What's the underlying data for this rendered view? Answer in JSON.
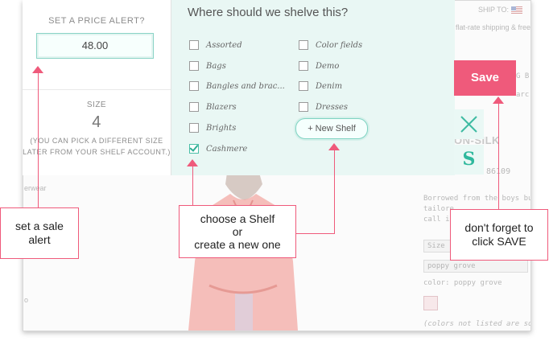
{
  "price_alert": {
    "heading": "SET A PRICE ALERT?",
    "value": "48.00"
  },
  "size": {
    "heading": "SIZE",
    "value": "4",
    "note_line1": "(YOU CAN PICK A DIFFERENT SIZE",
    "note_line2": "LATER FROM YOUR SHELF ACCOUNT.)"
  },
  "shelf": {
    "title": "Where should we shelve this?",
    "col1": [
      {
        "label": "Assorted",
        "checked": false
      },
      {
        "label": "Bags",
        "checked": false
      },
      {
        "label": "Bangles and brac...",
        "checked": false
      },
      {
        "label": "Blazers",
        "checked": false
      },
      {
        "label": "Brights",
        "checked": false
      },
      {
        "label": "Cashmere",
        "checked": true
      }
    ],
    "col2": [
      {
        "label": "Color fields",
        "checked": false
      },
      {
        "label": "Demo",
        "checked": false
      },
      {
        "label": "Denim",
        "checked": false
      },
      {
        "label": "Dresses",
        "checked": false
      }
    ],
    "new_shelf_label": "+ New Shelf"
  },
  "actions": {
    "save_label": "Save",
    "logo_letter": "S"
  },
  "background": {
    "ship_to": "SHIP TO:",
    "shipping_text": "flat-rate shipping & free",
    "frag_g": "G B",
    "frag_arc": "arc",
    "product_title": "ON-SILK PERF",
    "product_code": "86109",
    "desc_1": "Borrowed from the boys bu",
    "desc_2": "tailore",
    "desc_3": "call it",
    "size_select": "Size",
    "color_select": "poppy grove",
    "color_label": "color: poppy grove",
    "colors_note": "(colors not listed are sold ou",
    "left_frag_1": "erwear",
    "left_frag_2": "o"
  },
  "callouts": {
    "sale_alert_line1": "set a sale",
    "sale_alert_line2": "alert",
    "shelf_line1": "choose a Shelf",
    "shelf_line2": "or",
    "shelf_line3": "create a new one",
    "save_line1": "don't forget to",
    "save_line2": "click SAVE"
  },
  "colors": {
    "accent_pink": "#ef5a7b",
    "accent_mint": "#2fb89d",
    "shelf_bg": "#e9f7f4"
  }
}
